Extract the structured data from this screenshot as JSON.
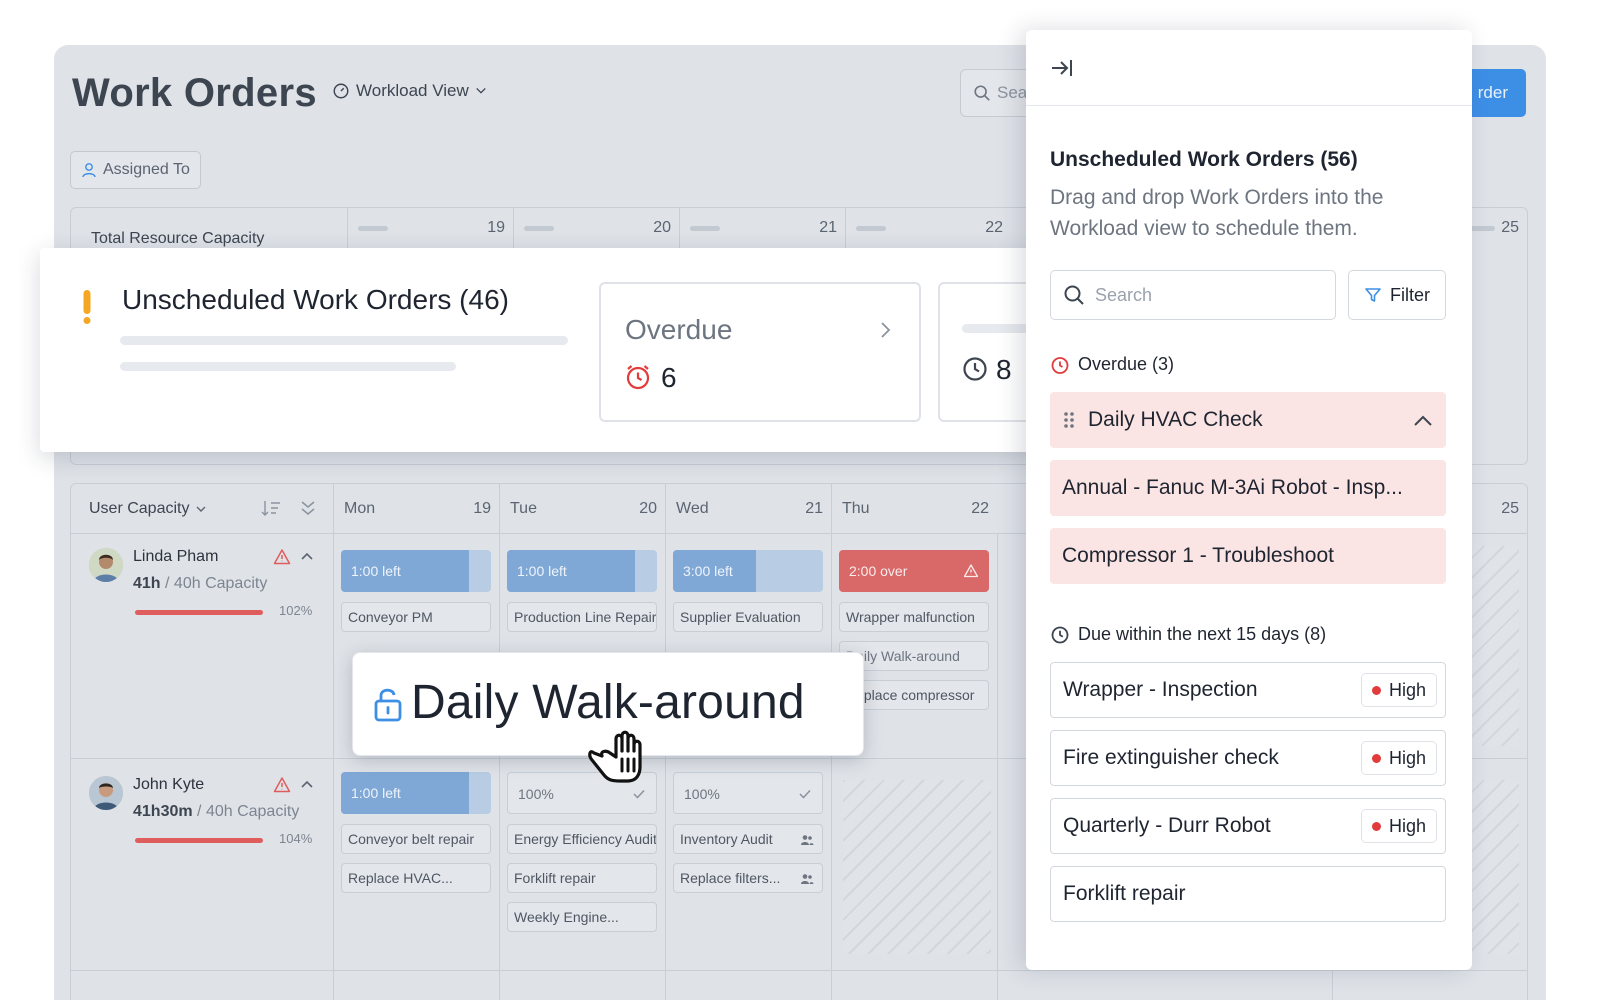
{
  "app": {
    "title": "Work Orders",
    "view_selector": "Workload View",
    "search_placeholder": "Sea",
    "create_button": "rder",
    "assigned_filter": "Assigned To"
  },
  "capacity": {
    "label": "Total Resource Capacity",
    "days": [
      "19",
      "20",
      "21",
      "22",
      "25"
    ]
  },
  "grid": {
    "user_capacity_label": "User Capacity",
    "columns": [
      {
        "day": "Mon",
        "num": "19"
      },
      {
        "day": "Tue",
        "num": "20"
      },
      {
        "day": "Wed",
        "num": "21"
      },
      {
        "day": "Thu",
        "num": "22"
      },
      {
        "day": "",
        "num": "25"
      }
    ],
    "users": [
      {
        "name": "Linda Pham",
        "hours": "41h",
        "capacity": "/ 40h Capacity",
        "percent": "102%",
        "chips": [
          {
            "kind": "blue",
            "label": "1:00 left",
            "fill": 0.85
          },
          {
            "kind": "blue",
            "label": "1:00 left",
            "fill": 0.85
          },
          {
            "kind": "blue",
            "label": "3:00 left",
            "fill": 0.55
          },
          {
            "kind": "red",
            "label": "2:00 over"
          }
        ],
        "tasks": [
          "Conveyor PM",
          "Production Line Repair",
          "Supplier Evaluation",
          "Wrapper malfunction",
          "Daily Walk-around",
          "Replace compressor"
        ]
      },
      {
        "name": "John Kyte",
        "hours": "41h30m",
        "capacity": "/ 40h Capacity",
        "percent": "104%",
        "chips": [
          {
            "kind": "blue",
            "label": "1:00 left",
            "fill": 0.85
          },
          {
            "kind": "plain",
            "label": "100%"
          },
          {
            "kind": "plain",
            "label": "100%"
          }
        ],
        "tasks": [
          "Conveyor belt repair",
          "Replace HVAC...",
          "Energy Efficiency Audit",
          "Forklift repair",
          "Weekly Engine...",
          "Inventory Audit",
          "Replace filters..."
        ]
      }
    ]
  },
  "summary": {
    "title": "Unscheduled Work Orders (46)",
    "overdue_label": "Overdue",
    "overdue_count": "6",
    "due_count": "8"
  },
  "drag": {
    "label": "Daily Walk-around"
  },
  "panel": {
    "title": "Unscheduled Work Orders (56)",
    "description": "Drag and drop Work Orders into the Workload view to schedule them.",
    "search_placeholder": "Search",
    "filter_label": "Filter",
    "overdue_heading": "Overdue (3)",
    "overdue_items": [
      "Daily HVAC Check",
      "Annual - Fanuc M-3Ai Robot - Insp...",
      "Compressor 1 - Troubleshoot"
    ],
    "due_heading": "Due within the next 15 days (8)",
    "due_items": [
      {
        "label": "Wrapper - Inspection",
        "priority": "High"
      },
      {
        "label": "Fire extinguisher check",
        "priority": "High"
      },
      {
        "label": "Quarterly - Durr Robot",
        "priority": "High"
      },
      {
        "label": "Forklift repair",
        "priority": ""
      }
    ]
  },
  "colors": {
    "accent": "#3d8fe6",
    "overdue": "#e23b3b",
    "warning": "#f5a623",
    "overdue_bg": "#fbe4e4"
  },
  "icons": [
    "workload-view-icon",
    "search-icon",
    "user-icon",
    "sort-icon",
    "collapse-all-icon",
    "warning-icon",
    "chevron-up-icon",
    "check-icon",
    "team-icon",
    "exclamation-icon",
    "clock-icon",
    "chevron-right-icon",
    "unlock-icon",
    "grab-hand-icon",
    "collapse-panel-icon",
    "filter-icon",
    "drag-handle-icon",
    "priority-dot-icon"
  ]
}
